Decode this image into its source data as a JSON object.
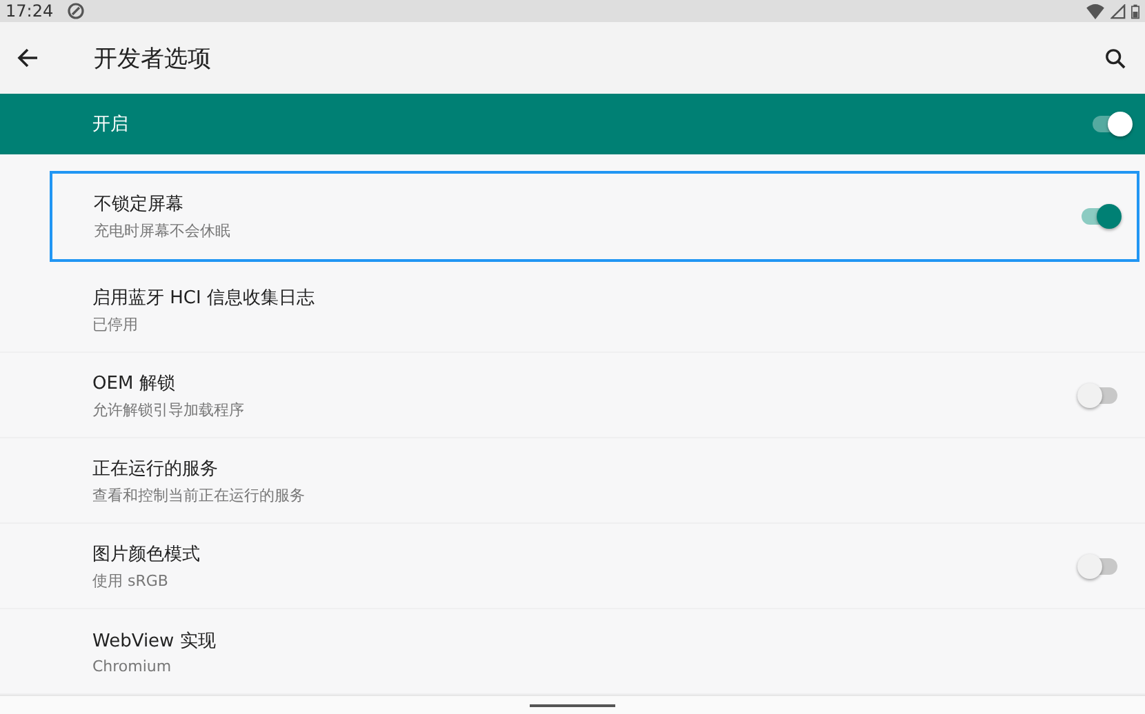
{
  "status_bar": {
    "time": "17:24"
  },
  "toolbar": {
    "title": "开发者选项"
  },
  "master_switch": {
    "label": "开启",
    "on": true
  },
  "settings": [
    {
      "title": "不锁定屏幕",
      "summary": "充电时屏幕不会休眠",
      "kind": "switch",
      "on": true,
      "focused": true
    },
    {
      "title": "启用蓝牙 HCI 信息收集日志",
      "summary": "已停用",
      "kind": "plain",
      "focused": false
    },
    {
      "title": "OEM 解锁",
      "summary": "允许解锁引导加载程序",
      "kind": "switch",
      "on": false,
      "focused": false
    },
    {
      "title": "正在运行的服务",
      "summary": "查看和控制当前正在运行的服务",
      "kind": "plain",
      "focused": false
    },
    {
      "title": "图片颜色模式",
      "summary": "使用 sRGB",
      "kind": "switch",
      "on": false,
      "focused": false
    },
    {
      "title": "WebView 实现",
      "summary": "Chromium",
      "kind": "plain",
      "focused": false
    }
  ]
}
